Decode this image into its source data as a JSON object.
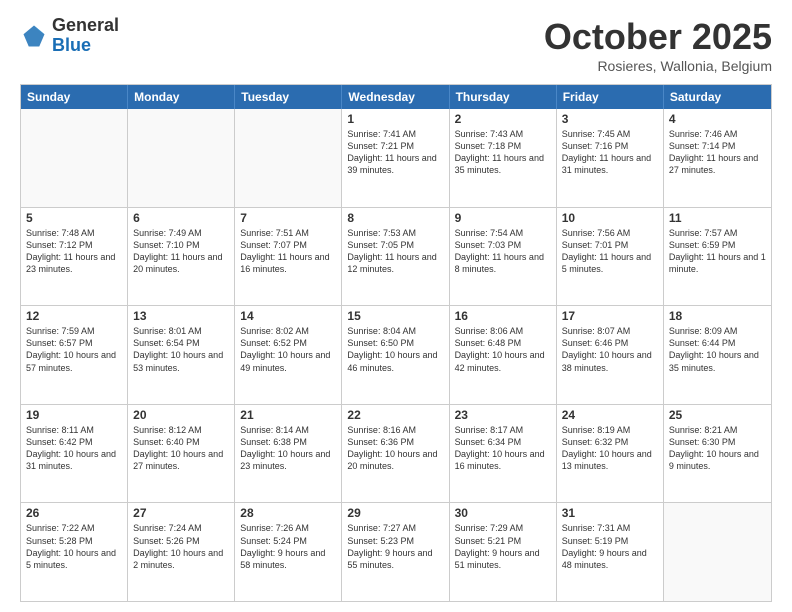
{
  "logo": {
    "general": "General",
    "blue": "Blue"
  },
  "header": {
    "month": "October 2025",
    "location": "Rosieres, Wallonia, Belgium"
  },
  "days": [
    "Sunday",
    "Monday",
    "Tuesday",
    "Wednesday",
    "Thursday",
    "Friday",
    "Saturday"
  ],
  "rows": [
    [
      {
        "day": "",
        "empty": true
      },
      {
        "day": "",
        "empty": true
      },
      {
        "day": "",
        "empty": true
      },
      {
        "day": "1",
        "sunrise": "Sunrise: 7:41 AM",
        "sunset": "Sunset: 7:21 PM",
        "daylight": "Daylight: 11 hours and 39 minutes."
      },
      {
        "day": "2",
        "sunrise": "Sunrise: 7:43 AM",
        "sunset": "Sunset: 7:18 PM",
        "daylight": "Daylight: 11 hours and 35 minutes."
      },
      {
        "day": "3",
        "sunrise": "Sunrise: 7:45 AM",
        "sunset": "Sunset: 7:16 PM",
        "daylight": "Daylight: 11 hours and 31 minutes."
      },
      {
        "day": "4",
        "sunrise": "Sunrise: 7:46 AM",
        "sunset": "Sunset: 7:14 PM",
        "daylight": "Daylight: 11 hours and 27 minutes."
      }
    ],
    [
      {
        "day": "5",
        "sunrise": "Sunrise: 7:48 AM",
        "sunset": "Sunset: 7:12 PM",
        "daylight": "Daylight: 11 hours and 23 minutes."
      },
      {
        "day": "6",
        "sunrise": "Sunrise: 7:49 AM",
        "sunset": "Sunset: 7:10 PM",
        "daylight": "Daylight: 11 hours and 20 minutes."
      },
      {
        "day": "7",
        "sunrise": "Sunrise: 7:51 AM",
        "sunset": "Sunset: 7:07 PM",
        "daylight": "Daylight: 11 hours and 16 minutes."
      },
      {
        "day": "8",
        "sunrise": "Sunrise: 7:53 AM",
        "sunset": "Sunset: 7:05 PM",
        "daylight": "Daylight: 11 hours and 12 minutes."
      },
      {
        "day": "9",
        "sunrise": "Sunrise: 7:54 AM",
        "sunset": "Sunset: 7:03 PM",
        "daylight": "Daylight: 11 hours and 8 minutes."
      },
      {
        "day": "10",
        "sunrise": "Sunrise: 7:56 AM",
        "sunset": "Sunset: 7:01 PM",
        "daylight": "Daylight: 11 hours and 5 minutes."
      },
      {
        "day": "11",
        "sunrise": "Sunrise: 7:57 AM",
        "sunset": "Sunset: 6:59 PM",
        "daylight": "Daylight: 11 hours and 1 minute."
      }
    ],
    [
      {
        "day": "12",
        "sunrise": "Sunrise: 7:59 AM",
        "sunset": "Sunset: 6:57 PM",
        "daylight": "Daylight: 10 hours and 57 minutes."
      },
      {
        "day": "13",
        "sunrise": "Sunrise: 8:01 AM",
        "sunset": "Sunset: 6:54 PM",
        "daylight": "Daylight: 10 hours and 53 minutes."
      },
      {
        "day": "14",
        "sunrise": "Sunrise: 8:02 AM",
        "sunset": "Sunset: 6:52 PM",
        "daylight": "Daylight: 10 hours and 49 minutes."
      },
      {
        "day": "15",
        "sunrise": "Sunrise: 8:04 AM",
        "sunset": "Sunset: 6:50 PM",
        "daylight": "Daylight: 10 hours and 46 minutes."
      },
      {
        "day": "16",
        "sunrise": "Sunrise: 8:06 AM",
        "sunset": "Sunset: 6:48 PM",
        "daylight": "Daylight: 10 hours and 42 minutes."
      },
      {
        "day": "17",
        "sunrise": "Sunrise: 8:07 AM",
        "sunset": "Sunset: 6:46 PM",
        "daylight": "Daylight: 10 hours and 38 minutes."
      },
      {
        "day": "18",
        "sunrise": "Sunrise: 8:09 AM",
        "sunset": "Sunset: 6:44 PM",
        "daylight": "Daylight: 10 hours and 35 minutes."
      }
    ],
    [
      {
        "day": "19",
        "sunrise": "Sunrise: 8:11 AM",
        "sunset": "Sunset: 6:42 PM",
        "daylight": "Daylight: 10 hours and 31 minutes."
      },
      {
        "day": "20",
        "sunrise": "Sunrise: 8:12 AM",
        "sunset": "Sunset: 6:40 PM",
        "daylight": "Daylight: 10 hours and 27 minutes."
      },
      {
        "day": "21",
        "sunrise": "Sunrise: 8:14 AM",
        "sunset": "Sunset: 6:38 PM",
        "daylight": "Daylight: 10 hours and 23 minutes."
      },
      {
        "day": "22",
        "sunrise": "Sunrise: 8:16 AM",
        "sunset": "Sunset: 6:36 PM",
        "daylight": "Daylight: 10 hours and 20 minutes."
      },
      {
        "day": "23",
        "sunrise": "Sunrise: 8:17 AM",
        "sunset": "Sunset: 6:34 PM",
        "daylight": "Daylight: 10 hours and 16 minutes."
      },
      {
        "day": "24",
        "sunrise": "Sunrise: 8:19 AM",
        "sunset": "Sunset: 6:32 PM",
        "daylight": "Daylight: 10 hours and 13 minutes."
      },
      {
        "day": "25",
        "sunrise": "Sunrise: 8:21 AM",
        "sunset": "Sunset: 6:30 PM",
        "daylight": "Daylight: 10 hours and 9 minutes."
      }
    ],
    [
      {
        "day": "26",
        "sunrise": "Sunrise: 7:22 AM",
        "sunset": "Sunset: 5:28 PM",
        "daylight": "Daylight: 10 hours and 5 minutes."
      },
      {
        "day": "27",
        "sunrise": "Sunrise: 7:24 AM",
        "sunset": "Sunset: 5:26 PM",
        "daylight": "Daylight: 10 hours and 2 minutes."
      },
      {
        "day": "28",
        "sunrise": "Sunrise: 7:26 AM",
        "sunset": "Sunset: 5:24 PM",
        "daylight": "Daylight: 9 hours and 58 minutes."
      },
      {
        "day": "29",
        "sunrise": "Sunrise: 7:27 AM",
        "sunset": "Sunset: 5:23 PM",
        "daylight": "Daylight: 9 hours and 55 minutes."
      },
      {
        "day": "30",
        "sunrise": "Sunrise: 7:29 AM",
        "sunset": "Sunset: 5:21 PM",
        "daylight": "Daylight: 9 hours and 51 minutes."
      },
      {
        "day": "31",
        "sunrise": "Sunrise: 7:31 AM",
        "sunset": "Sunset: 5:19 PM",
        "daylight": "Daylight: 9 hours and 48 minutes."
      },
      {
        "day": "",
        "empty": true
      }
    ]
  ]
}
